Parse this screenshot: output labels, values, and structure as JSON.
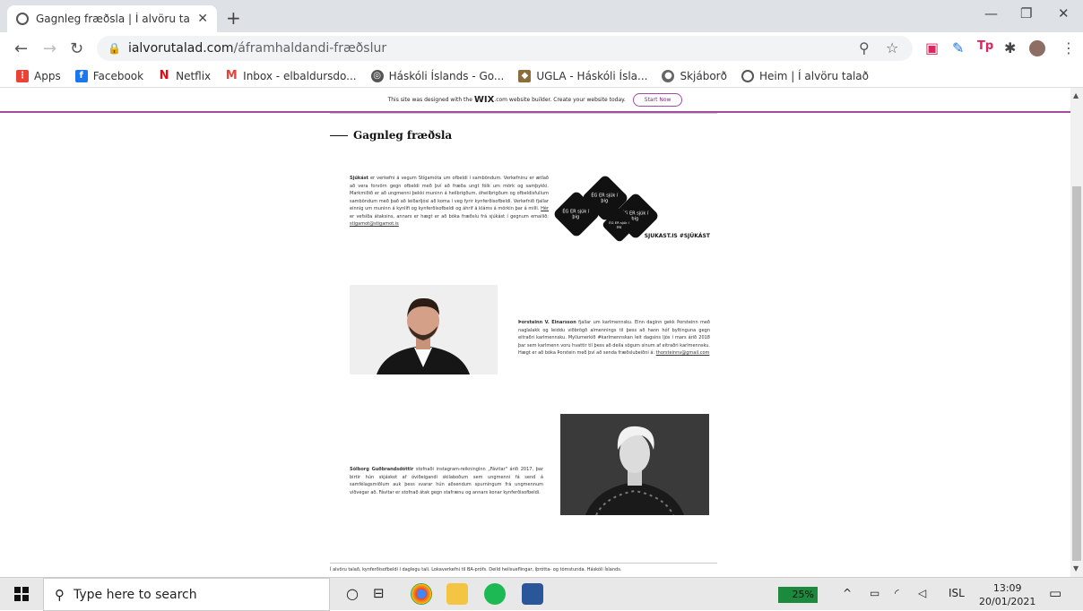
{
  "browser": {
    "tab_title": "Gagnleg fræðsla | Í alvöru talað",
    "url_host": "ialvorutalad.com",
    "url_path": "/áframhaldandi-fræðslur",
    "bookmarks": [
      {
        "label": "Apps",
        "icon": "apps-grid-icon",
        "color": "#ea4335"
      },
      {
        "label": "Facebook",
        "icon": "facebook-icon",
        "color": "#1877f2"
      },
      {
        "label": "Netflix",
        "icon": "netflix-icon",
        "color": "#e50914"
      },
      {
        "label": "Inbox - elbaldursdo...",
        "icon": "gmail-icon",
        "color": "#ea4335"
      },
      {
        "label": "Háskóli Íslands - Go...",
        "icon": "globe-icon",
        "color": "#555555"
      },
      {
        "label": "UGLA - Háskóli Ísla...",
        "icon": "ugla-icon",
        "color": "#8a6d3b"
      },
      {
        "label": "Skjáborð",
        "icon": "skjabord-icon",
        "color": "#666666"
      },
      {
        "label": "Heim | Í alvöru talað",
        "icon": "globe-icon",
        "color": "#555555"
      }
    ]
  },
  "wix_banner": {
    "text_before": "This site was designed with the",
    "brand": "WIX",
    "text_after": ".com website builder. Create your website today.",
    "start_label": "Start Now"
  },
  "page": {
    "heading": "Gagnleg fræðsla",
    "block1": {
      "bold": "Sjúkást",
      "text": " er verkefni á vegum Stígamóta um ofbeldi í samböndum. Verkefninu er ætlað að vera forvörn gegn ofbeldi með því að fræða ungt fólk um mörk og samþykki. Markmiðið er að ungmenni þekki muninn á heilbrigðum, óheilbrigðum og ofbeldisfullum samböndum með það að leiðarljósi að koma í veg fyrir kynferðisofbeldi. Verkefnið fjallar einnig um muninn á kynlífi og kynferðisofbeldi og áhrif á kláms á mörkin þar á milli.",
      "link_word": "Hér",
      "text2": " er vefsíða átaksins, annars er hægt er að bóka fræðslu frá sjúkást í gegnum emailið:",
      "email": "stigamot@stigamot.is"
    },
    "hearts_caption": "SJUKAST.IS  #SJÚKÁST",
    "heart_texts": [
      "ÉG ER sjúk í þig",
      "ÉG ER sjúk í þig",
      "ÉG ER sjúk í þig",
      "ÉG ER sjúk í þig"
    ],
    "block2": {
      "bold": "Þorsteinn V. Einarsson",
      "text": " fjallar um karlmennsku. Einn daginn gekk Þorsteinn með naglalakk og leiddu viðbrögð almennings til þess að hann hóf byltinguna gegn eitraðri karlmennsku. Myllumerkið #karlmennskan leit dagsins ljós í mars árið 2018 þar sem karlmenn voru hvattir til þess að deila sögum sínum af eitraðri karlmennsku. Hægt er að bóka Þorstein með því að senda fræðslubeiðni á:",
      "email": "thorsteinnv@gmail.com"
    },
    "block3": {
      "bold": "Sólborg Guðbrandsdóttir",
      "text": " stofnaði instagram-reikninginn „Fávitar\" árið 2017, þar birtir hún skjáskot af óviðeigandi skilaboðum sem ungmenni fá send á samfélagsmiðlum auk þess svarar hún aðsendum spurningum frá ungmennum viðvegar að. Fávitar er stofnað átak gegn stafrænu og annars konar kynferðisofbeldi."
    },
    "footer": "Í alvöru talað, kynferðisofbeldi í daglegu tali. Lokaverkefni til BA-prófs. Deild heilsueflingar, íþrótta- og tómstunda. Háskóli Íslands."
  },
  "taskbar": {
    "search_placeholder": "Type here to search",
    "battery": "25%",
    "language": "ISL",
    "time": "13:09",
    "date": "20/01/2021"
  }
}
